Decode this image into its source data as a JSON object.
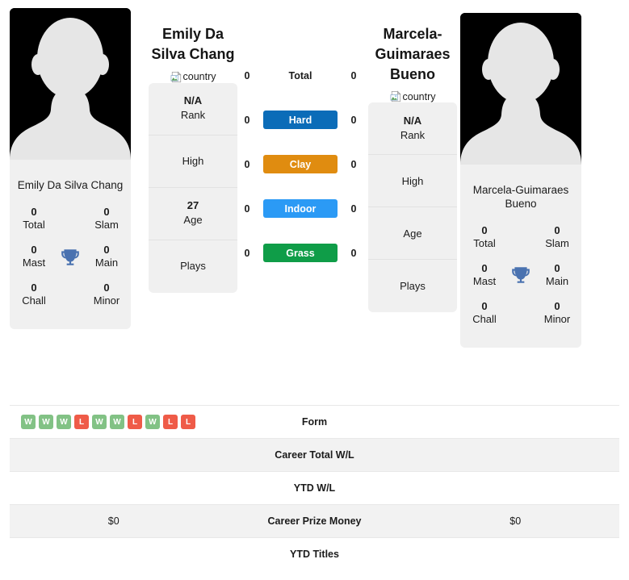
{
  "colors": {
    "hard": "#0b6cb8",
    "clay": "#e08c10",
    "indoor": "#2b9af5",
    "grass": "#0f9d48",
    "win": "#82c285",
    "loss": "#ef5b48",
    "trophy": "#4a72b0",
    "card_bg": "#f0f0f0",
    "row_shade": "#f2f2f2"
  },
  "players": {
    "left": {
      "display_name": "Emily Da\nSilva Chang",
      "title_line1": "Emily Da",
      "title_line2": "Silva Chang",
      "card_name": "Emily Da Silva Chang",
      "country_alt": "country",
      "photo_alt": "player-photo",
      "titles": [
        {
          "value": "0",
          "label": "Total"
        },
        {
          "value": "0",
          "label": "Slam"
        },
        {
          "value": "0",
          "label": "Mast"
        },
        {
          "value": "0",
          "label": "Main"
        },
        {
          "value": "0",
          "label": "Chall"
        },
        {
          "value": "0",
          "label": "Minor"
        }
      ],
      "info": [
        {
          "value": "N/A",
          "label": "Rank"
        },
        {
          "value": "",
          "label": "High"
        },
        {
          "value": "27",
          "label": "Age"
        },
        {
          "value": "",
          "label": "Plays"
        }
      ],
      "surface_values": {
        "total": "0",
        "hard": "0",
        "clay": "0",
        "indoor": "0",
        "grass": "0"
      },
      "form": [
        "W",
        "W",
        "W",
        "L",
        "W",
        "W",
        "L",
        "W",
        "L",
        "L"
      ],
      "career_total_wl": "",
      "ytd_wl": "",
      "career_prize_money": "$0",
      "ytd_titles": ""
    },
    "right": {
      "display_name": "Marcela-\nGuimaraes\nBueno",
      "title_line1": "Marcela-",
      "title_line2": "Guimaraes",
      "title_line3": "Bueno",
      "card_name": "Marcela-Guimaraes Bueno",
      "country_alt": "country",
      "photo_alt": "player-photo",
      "titles": [
        {
          "value": "0",
          "label": "Total"
        },
        {
          "value": "0",
          "label": "Slam"
        },
        {
          "value": "0",
          "label": "Mast"
        },
        {
          "value": "0",
          "label": "Main"
        },
        {
          "value": "0",
          "label": "Chall"
        },
        {
          "value": "0",
          "label": "Minor"
        }
      ],
      "info": [
        {
          "value": "N/A",
          "label": "Rank"
        },
        {
          "value": "",
          "label": "High"
        },
        {
          "value": "",
          "label": "Age"
        },
        {
          "value": "",
          "label": "Plays"
        }
      ],
      "surface_values": {
        "total": "0",
        "hard": "0",
        "clay": "0",
        "indoor": "0",
        "grass": "0"
      },
      "form": [],
      "career_total_wl": "",
      "ytd_wl": "",
      "career_prize_money": "$0",
      "ytd_titles": ""
    }
  },
  "surfaces": [
    {
      "key": "total",
      "label": "Total",
      "style": "plain"
    },
    {
      "key": "hard",
      "label": "Hard",
      "style": "hard"
    },
    {
      "key": "clay",
      "label": "Clay",
      "style": "clay"
    },
    {
      "key": "indoor",
      "label": "Indoor",
      "style": "indoor"
    },
    {
      "key": "grass",
      "label": "Grass",
      "style": "grass"
    }
  ],
  "stat_rows": [
    {
      "label": "Form",
      "type": "form"
    },
    {
      "label": "Career Total W/L",
      "type": "text"
    },
    {
      "label": "YTD W/L",
      "type": "text"
    },
    {
      "label": "Career Prize Money",
      "type": "text"
    },
    {
      "label": "YTD Titles",
      "type": "text"
    }
  ]
}
